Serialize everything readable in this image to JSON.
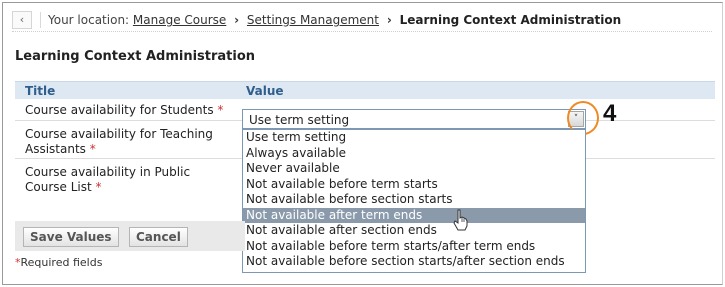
{
  "breadcrumb": {
    "back_icon": "chevron-left-icon",
    "location_label": "Your location:",
    "items": [
      "Manage Course",
      "Settings Management"
    ],
    "separator": "›",
    "current": "Learning Context Administration"
  },
  "page_title": "Learning Context Administration",
  "table": {
    "headers": {
      "title": "Title",
      "value": "Value"
    },
    "rows": [
      {
        "label": "Course availability for Students",
        "required_mark": "*"
      },
      {
        "label": "Course availability for Teaching Assistants",
        "required_mark": "*"
      },
      {
        "label": "Course availability in Public Course List",
        "required_mark": "*"
      }
    ]
  },
  "select": {
    "value": "Use term setting",
    "arrow": "˅",
    "options": [
      "Use term setting",
      "Always available",
      "Never available",
      "Not available before term starts",
      "Not available before section starts",
      "Not available after term ends",
      "Not available after section ends",
      "Not available before term starts/after term ends",
      "Not available before section starts/after section ends"
    ],
    "hovered_option": "Not available after term ends"
  },
  "callout": {
    "number": "4",
    "color": "#f08a24"
  },
  "buttons": {
    "save": "Save Values",
    "cancel": "Cancel"
  },
  "required_note": {
    "mark": "*",
    "text": "Required fields"
  },
  "colors": {
    "header_bg": "#dde8f3",
    "header_text": "#2f5e8c",
    "required": "#d12f2f",
    "hover": "#8a9aab"
  }
}
